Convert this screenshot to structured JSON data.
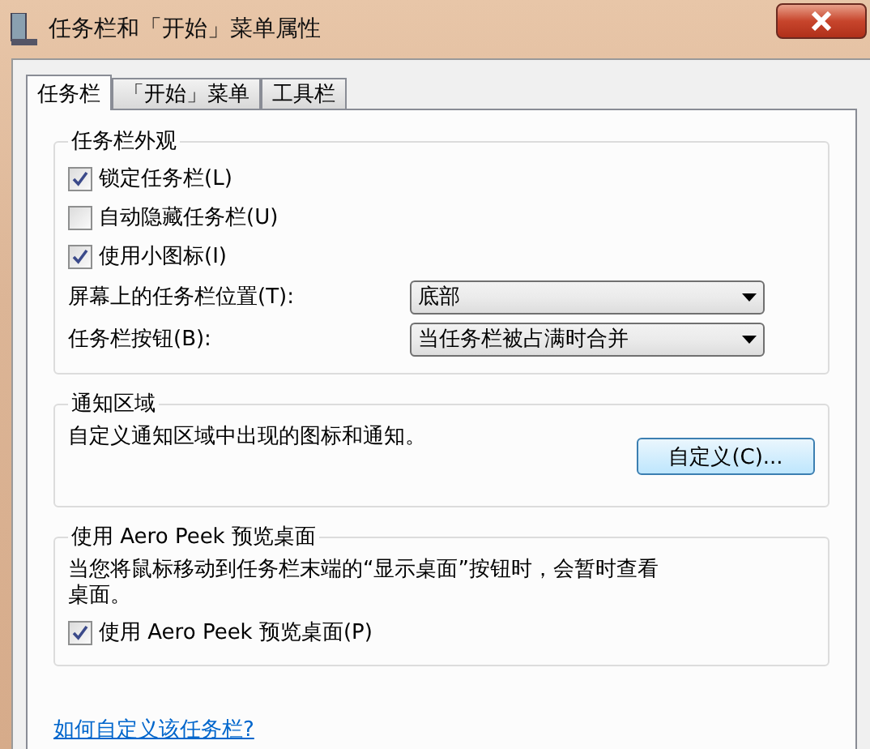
{
  "window": {
    "title": "任务栏和「开始」菜单属性"
  },
  "tabs": [
    {
      "label": "任务栏",
      "selected": true
    },
    {
      "label": "「开始」菜单",
      "selected": false
    },
    {
      "label": "工具栏",
      "selected": false
    }
  ],
  "appearance": {
    "title": "任务栏外观",
    "checkboxes": [
      {
        "label": "锁定任务栏(L)",
        "checked": true
      },
      {
        "label": "自动隐藏任务栏(U)",
        "checked": false
      },
      {
        "label": "使用小图标(I)",
        "checked": true
      }
    ],
    "dropdowns": [
      {
        "label": "屏幕上的任务栏位置(T):",
        "value": "底部"
      },
      {
        "label": "任务栏按钮(B):",
        "value": "当任务栏被占满时合并"
      }
    ]
  },
  "notification_area": {
    "title": "通知区域",
    "text": "自定义通知区域中出现的图标和通知。",
    "button": "自定义(C)..."
  },
  "aero_peek": {
    "title": "使用 Aero Peek 预览桌面",
    "text": "当您将鼠标移动到任务栏末端的“显示桌面”按钮时，会暂时查看桌面。",
    "checkbox": {
      "label": "使用 Aero Peek 预览桌面(P)",
      "checked": true
    }
  },
  "help_link": "如何自定义该任务栏?"
}
